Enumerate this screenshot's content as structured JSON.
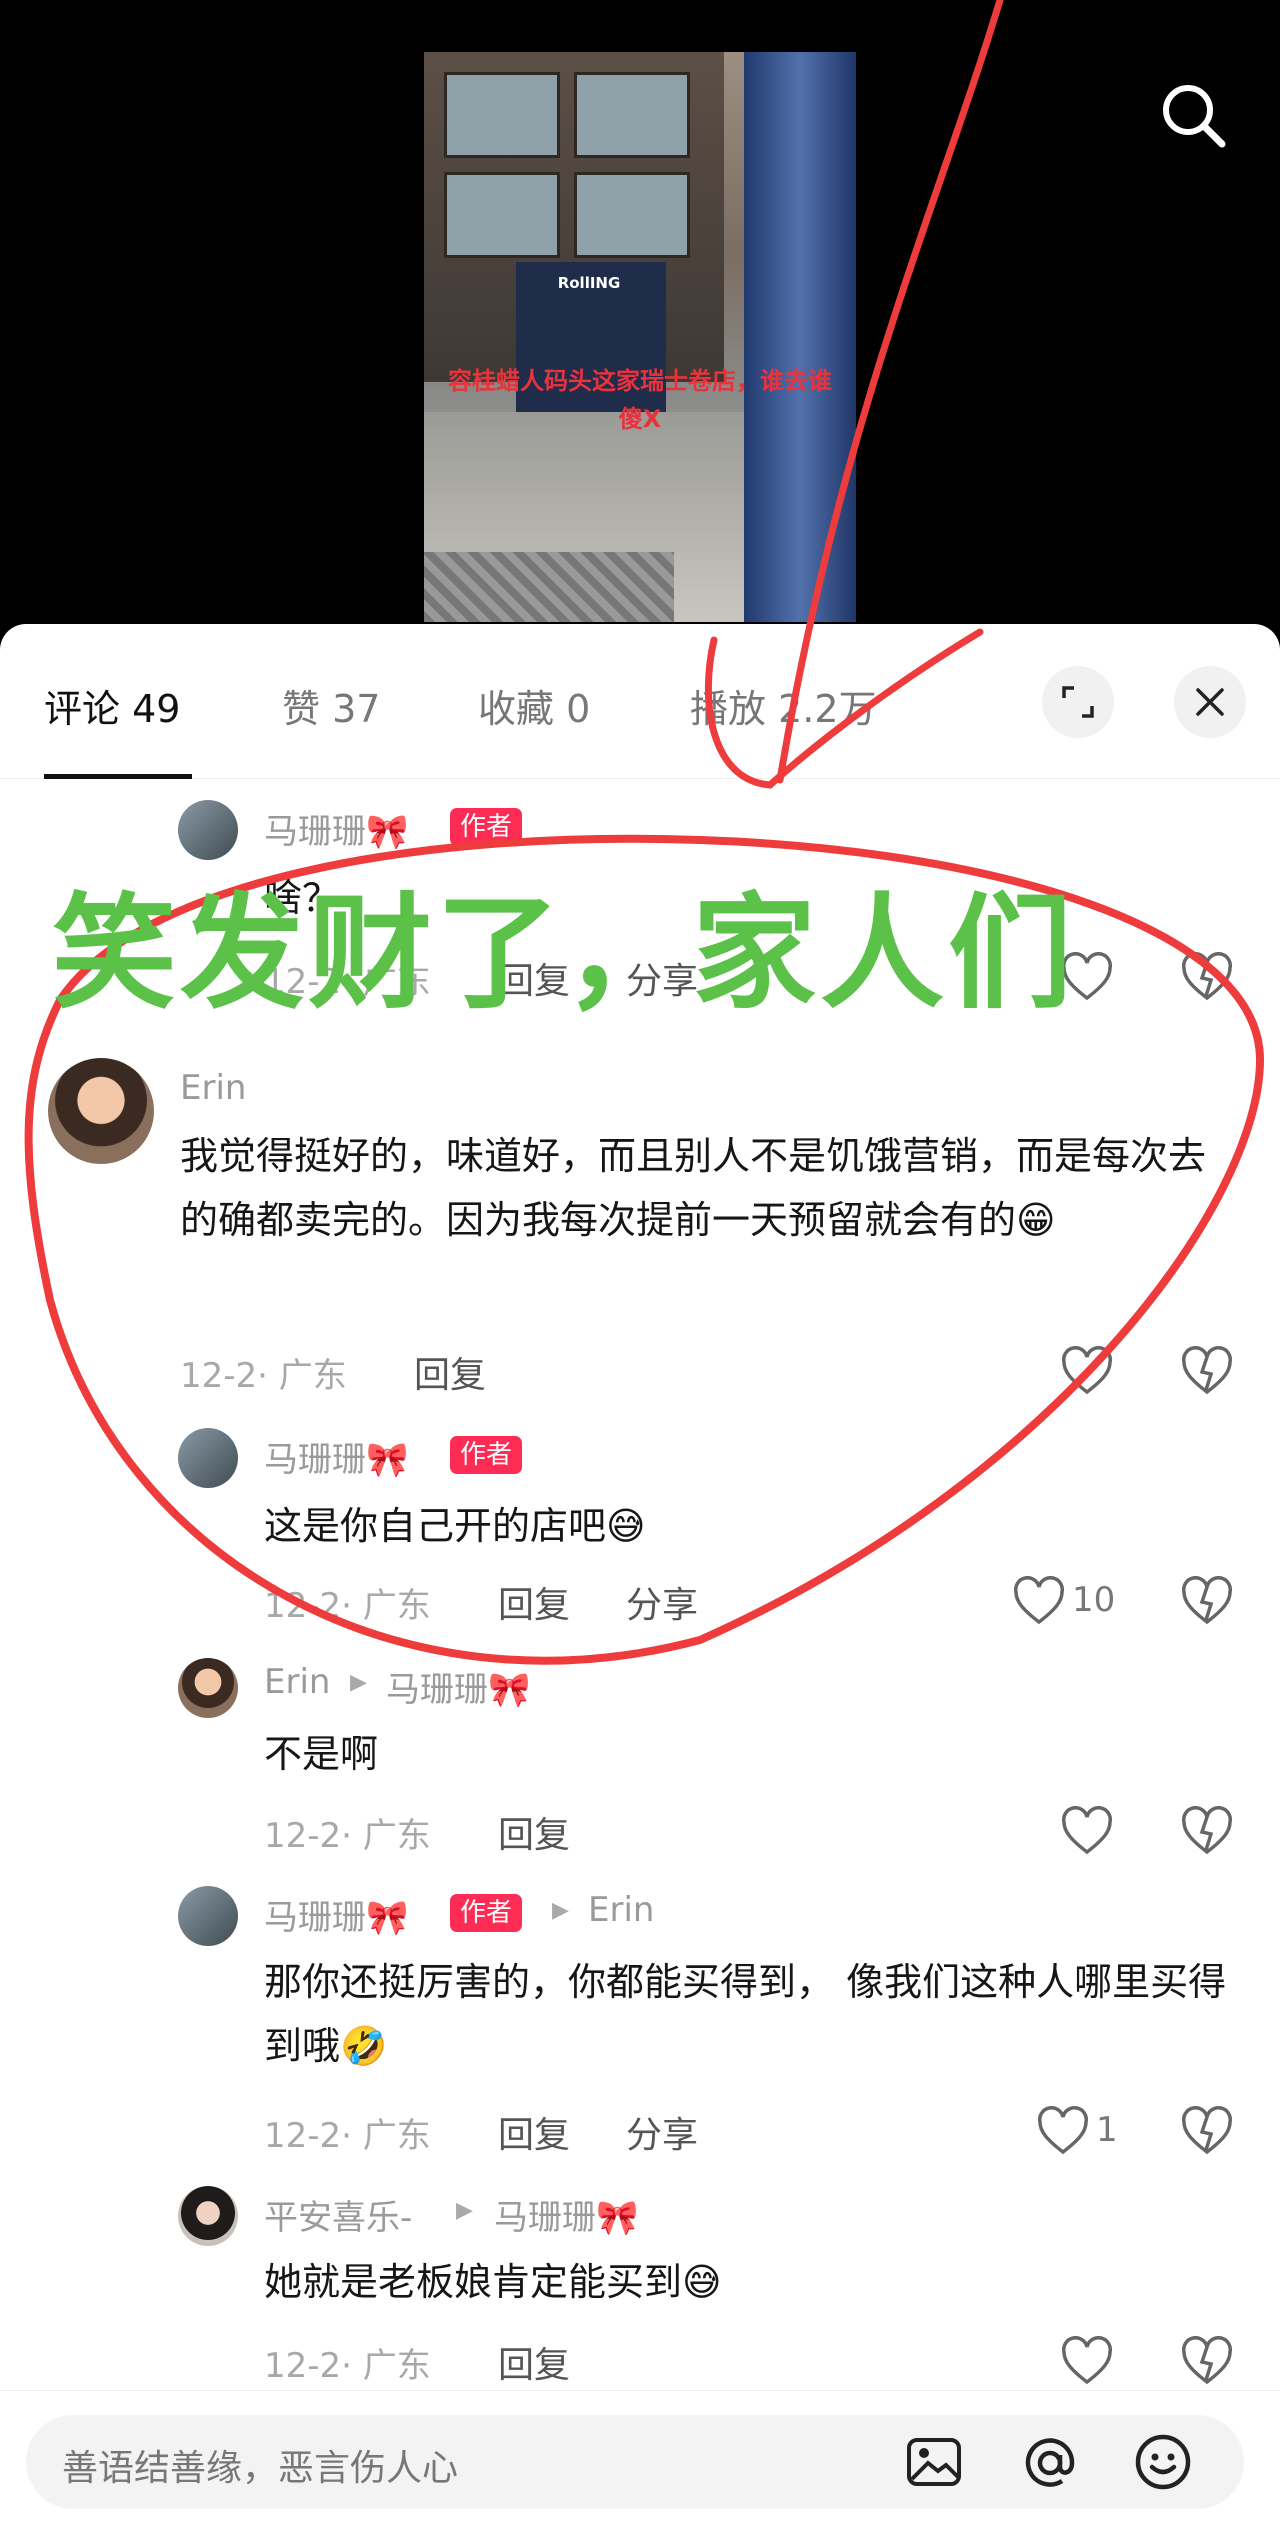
{
  "video": {
    "caption": "容桂蜡人码头这家瑞士卷店，谁去谁傻X",
    "shop_sign": "RollING"
  },
  "tabs": [
    {
      "label": "评论 49",
      "active": true
    },
    {
      "label": "赞 37",
      "active": false
    },
    {
      "label": "收藏 0",
      "active": false
    },
    {
      "label": "播放 2.2万",
      "active": false
    }
  ],
  "comments": [
    {
      "user": "马珊珊🎀",
      "badge": "作者",
      "text": "啥？",
      "date": "12-2· 广东",
      "reply": "回复",
      "share": "分享",
      "likes": ""
    },
    {
      "user": "Erin",
      "text": "我觉得挺好的，味道好，而且别人不是饥饿营销，而是每次去的确都卖完的。因为我每次提前一天预留就会有的😁",
      "date": "12-2· 广东",
      "reply": "回复",
      "likes": ""
    },
    {
      "user": "马珊珊🎀",
      "badge": "作者",
      "text": "这是你自己开的店吧😅",
      "date": "12-2· 广东",
      "reply": "回复",
      "share": "分享",
      "likes": "10"
    },
    {
      "user": "Erin",
      "reply_to": "马珊珊🎀",
      "text": "不是啊",
      "date": "12-2· 广东",
      "reply": "回复",
      "likes": ""
    },
    {
      "user": "马珊珊🎀",
      "badge": "作者",
      "reply_to": "Erin",
      "text": "那你还挺厉害的，你都能买得到， 像我们这种人哪里买得到哦🤣",
      "date": "12-2· 广东",
      "reply": "回复",
      "share": "分享",
      "likes": "1"
    },
    {
      "user": "平安喜乐-",
      "reply_to": "马珊珊🎀",
      "text": "她就是老板娘肯定能买到😅",
      "date": "12-2· 广东",
      "reply": "回复",
      "likes": ""
    }
  ],
  "input": {
    "placeholder": "善语结善缘，恶言伤人心"
  },
  "annotation": {
    "text": "笑发财了，家人们",
    "circle_color": "#ee3b3b",
    "text_color": "#5bc149"
  },
  "colors": {
    "badge": "#fe2c55",
    "annotation": "#ee3b3b"
  }
}
